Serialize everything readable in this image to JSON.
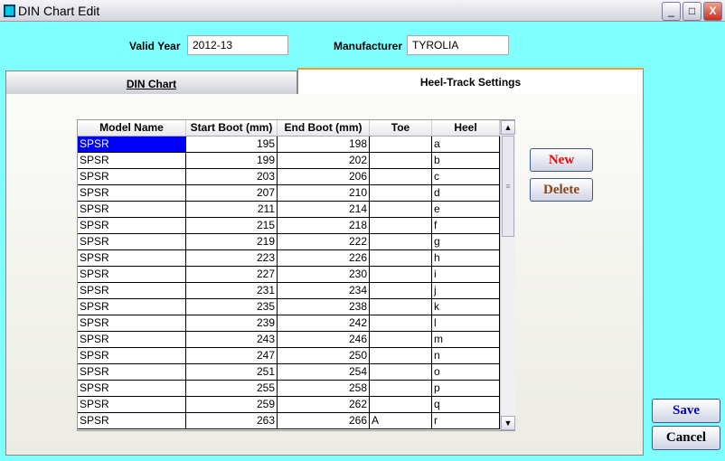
{
  "window": {
    "title": "DIN Chart Edit",
    "minimize": "_",
    "maximize": "□",
    "close": "X"
  },
  "form": {
    "valid_year_label": "Valid Year",
    "valid_year": "2012-13",
    "manufacturer_label": "Manufacturer",
    "manufacturer": "TYROLIA"
  },
  "tabs": [
    {
      "label": "DIN Chart"
    },
    {
      "label": "Heel-Track Settings"
    }
  ],
  "table": {
    "columns": [
      "Model Name",
      "Start Boot (mm)",
      "End Boot (mm)",
      "Toe",
      "Heel"
    ],
    "rows": [
      [
        "SPSR",
        "195",
        "198",
        "",
        "a"
      ],
      [
        "SPSR",
        "199",
        "202",
        "",
        "b"
      ],
      [
        "SPSR",
        "203",
        "206",
        "",
        "c"
      ],
      [
        "SPSR",
        "207",
        "210",
        "",
        "d"
      ],
      [
        "SPSR",
        "211",
        "214",
        "",
        "e"
      ],
      [
        "SPSR",
        "215",
        "218",
        "",
        "f"
      ],
      [
        "SPSR",
        "219",
        "222",
        "",
        "g"
      ],
      [
        "SPSR",
        "223",
        "226",
        "",
        "h"
      ],
      [
        "SPSR",
        "227",
        "230",
        "",
        "i"
      ],
      [
        "SPSR",
        "231",
        "234",
        "",
        "j"
      ],
      [
        "SPSR",
        "235",
        "238",
        "",
        "k"
      ],
      [
        "SPSR",
        "239",
        "242",
        "",
        "l"
      ],
      [
        "SPSR",
        "243",
        "246",
        "",
        "m"
      ],
      [
        "SPSR",
        "247",
        "250",
        "",
        "n"
      ],
      [
        "SPSR",
        "251",
        "254",
        "",
        "o"
      ],
      [
        "SPSR",
        "255",
        "258",
        "",
        "p"
      ],
      [
        "SPSR",
        "259",
        "262",
        "",
        "q"
      ],
      [
        "SPSR",
        "263",
        "266",
        "A",
        "r"
      ]
    ]
  },
  "buttons": {
    "new": "New",
    "delete": "Delete",
    "save": "Save",
    "cancel": "Cancel"
  },
  "colors": {
    "background": "#80ffff",
    "selection": "#0000ff",
    "new": "#ff0000",
    "delete": "#8b4513",
    "save": "#0000cc"
  }
}
